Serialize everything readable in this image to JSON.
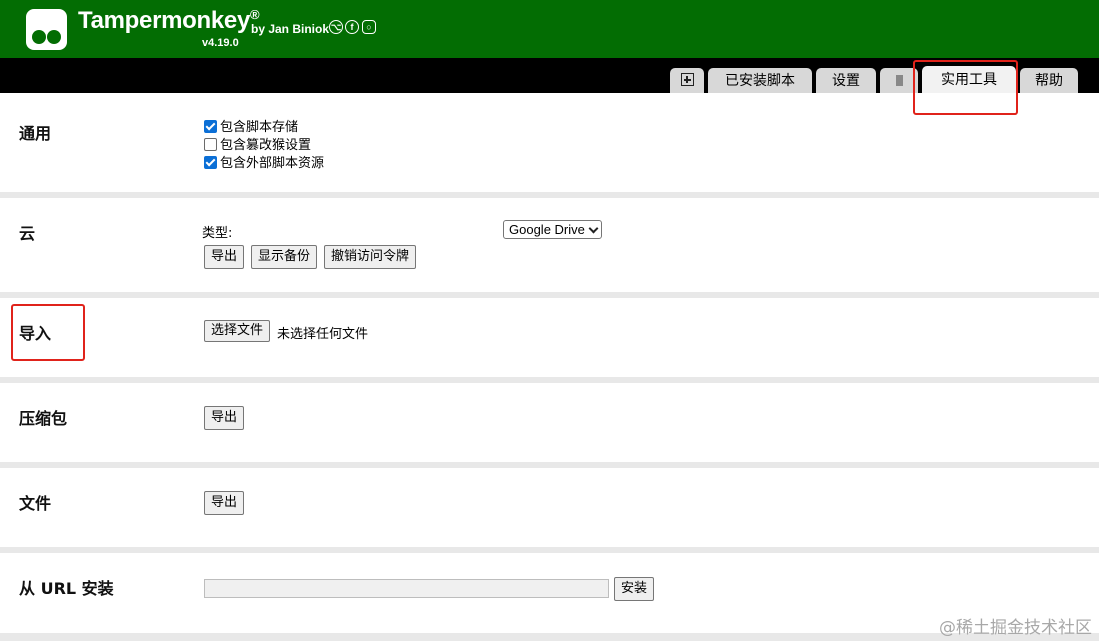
{
  "header": {
    "app_name": "Tampermonkey",
    "registered": "®",
    "by": "by Jan Biniok",
    "version": "v4.19.0",
    "social_icons": [
      "github-icon",
      "facebook-icon",
      "instagram-icon"
    ]
  },
  "tabs": {
    "new_script": "plus-square-icon",
    "installed": "已安装脚本",
    "settings": "设置",
    "trash": "trash-icon",
    "utilities": "实用工具",
    "help": "帮助"
  },
  "general": {
    "title": "通用",
    "options": [
      {
        "label": "包含脚本存储",
        "checked": true
      },
      {
        "label": "包含篡改猴设置",
        "checked": false
      },
      {
        "label": "包含外部脚本资源",
        "checked": true
      }
    ]
  },
  "cloud": {
    "title": "云",
    "type_label": "类型:",
    "type_value": "Google Drive",
    "buttons": {
      "export": "导出",
      "show_backups": "显示备份",
      "revoke_token": "撤销访问令牌"
    }
  },
  "import": {
    "title": "导入",
    "choose_file": "选择文件",
    "no_file": "未选择任何文件"
  },
  "zip": {
    "title": "压缩包",
    "export": "导出"
  },
  "file": {
    "title": "文件",
    "export": "导出"
  },
  "url_install": {
    "title": "从 URL 安装",
    "value": "",
    "install": "安装"
  },
  "watermark": "@稀土掘金技术社区",
  "colors": {
    "header_bg": "#036d03",
    "tabbar_bg": "#000000",
    "highlight": "#e0231b",
    "checkbox": "#0b6fd6"
  }
}
